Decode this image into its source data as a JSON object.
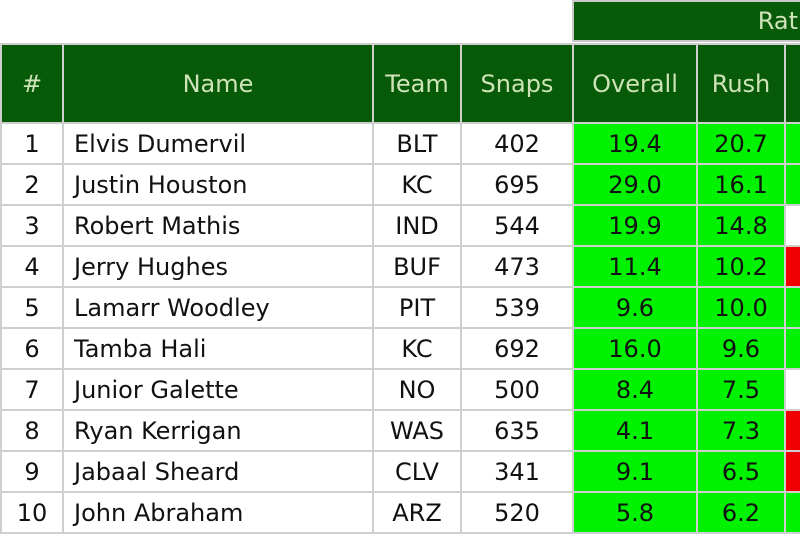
{
  "group_header": "Rat",
  "columns": [
    "#",
    "Name",
    "Team",
    "Snaps",
    "Overall",
    "Rush",
    ""
  ],
  "colors": {
    "header_bg": "#075a07",
    "header_text": "#cfe3b8",
    "good": "#00f200",
    "bad": "#f00000"
  },
  "rows": [
    {
      "rank": "1",
      "name": "Elvis Dumervil",
      "team": "BLT",
      "snaps": "402",
      "overall": "19.4",
      "rush": "20.7",
      "next": "g"
    },
    {
      "rank": "2",
      "name": "Justin Houston",
      "team": "KC",
      "snaps": "695",
      "overall": "29.0",
      "rush": "16.1",
      "next": "g"
    },
    {
      "rank": "3",
      "name": "Robert Mathis",
      "team": "IND",
      "snaps": "544",
      "overall": "19.9",
      "rush": "14.8",
      "next": "w"
    },
    {
      "rank": "4",
      "name": "Jerry Hughes",
      "team": "BUF",
      "snaps": "473",
      "overall": "11.4",
      "rush": "10.2",
      "next": "r"
    },
    {
      "rank": "5",
      "name": "Lamarr Woodley",
      "team": "PIT",
      "snaps": "539",
      "overall": "9.6",
      "rush": "10.0",
      "next": "g"
    },
    {
      "rank": "6",
      "name": "Tamba Hali",
      "team": "KC",
      "snaps": "692",
      "overall": "16.0",
      "rush": "9.6",
      "next": "g"
    },
    {
      "rank": "7",
      "name": "Junior Galette",
      "team": "NO",
      "snaps": "500",
      "overall": "8.4",
      "rush": "7.5",
      "next": "w"
    },
    {
      "rank": "8",
      "name": "Ryan Kerrigan",
      "team": "WAS",
      "snaps": "635",
      "overall": "4.1",
      "rush": "7.3",
      "next": "r"
    },
    {
      "rank": "9",
      "name": "Jabaal Sheard",
      "team": "CLV",
      "snaps": "341",
      "overall": "9.1",
      "rush": "6.5",
      "next": "r"
    },
    {
      "rank": "10",
      "name": "John Abraham",
      "team": "ARZ",
      "snaps": "520",
      "overall": "5.8",
      "rush": "6.2",
      "next": "g"
    }
  ]
}
